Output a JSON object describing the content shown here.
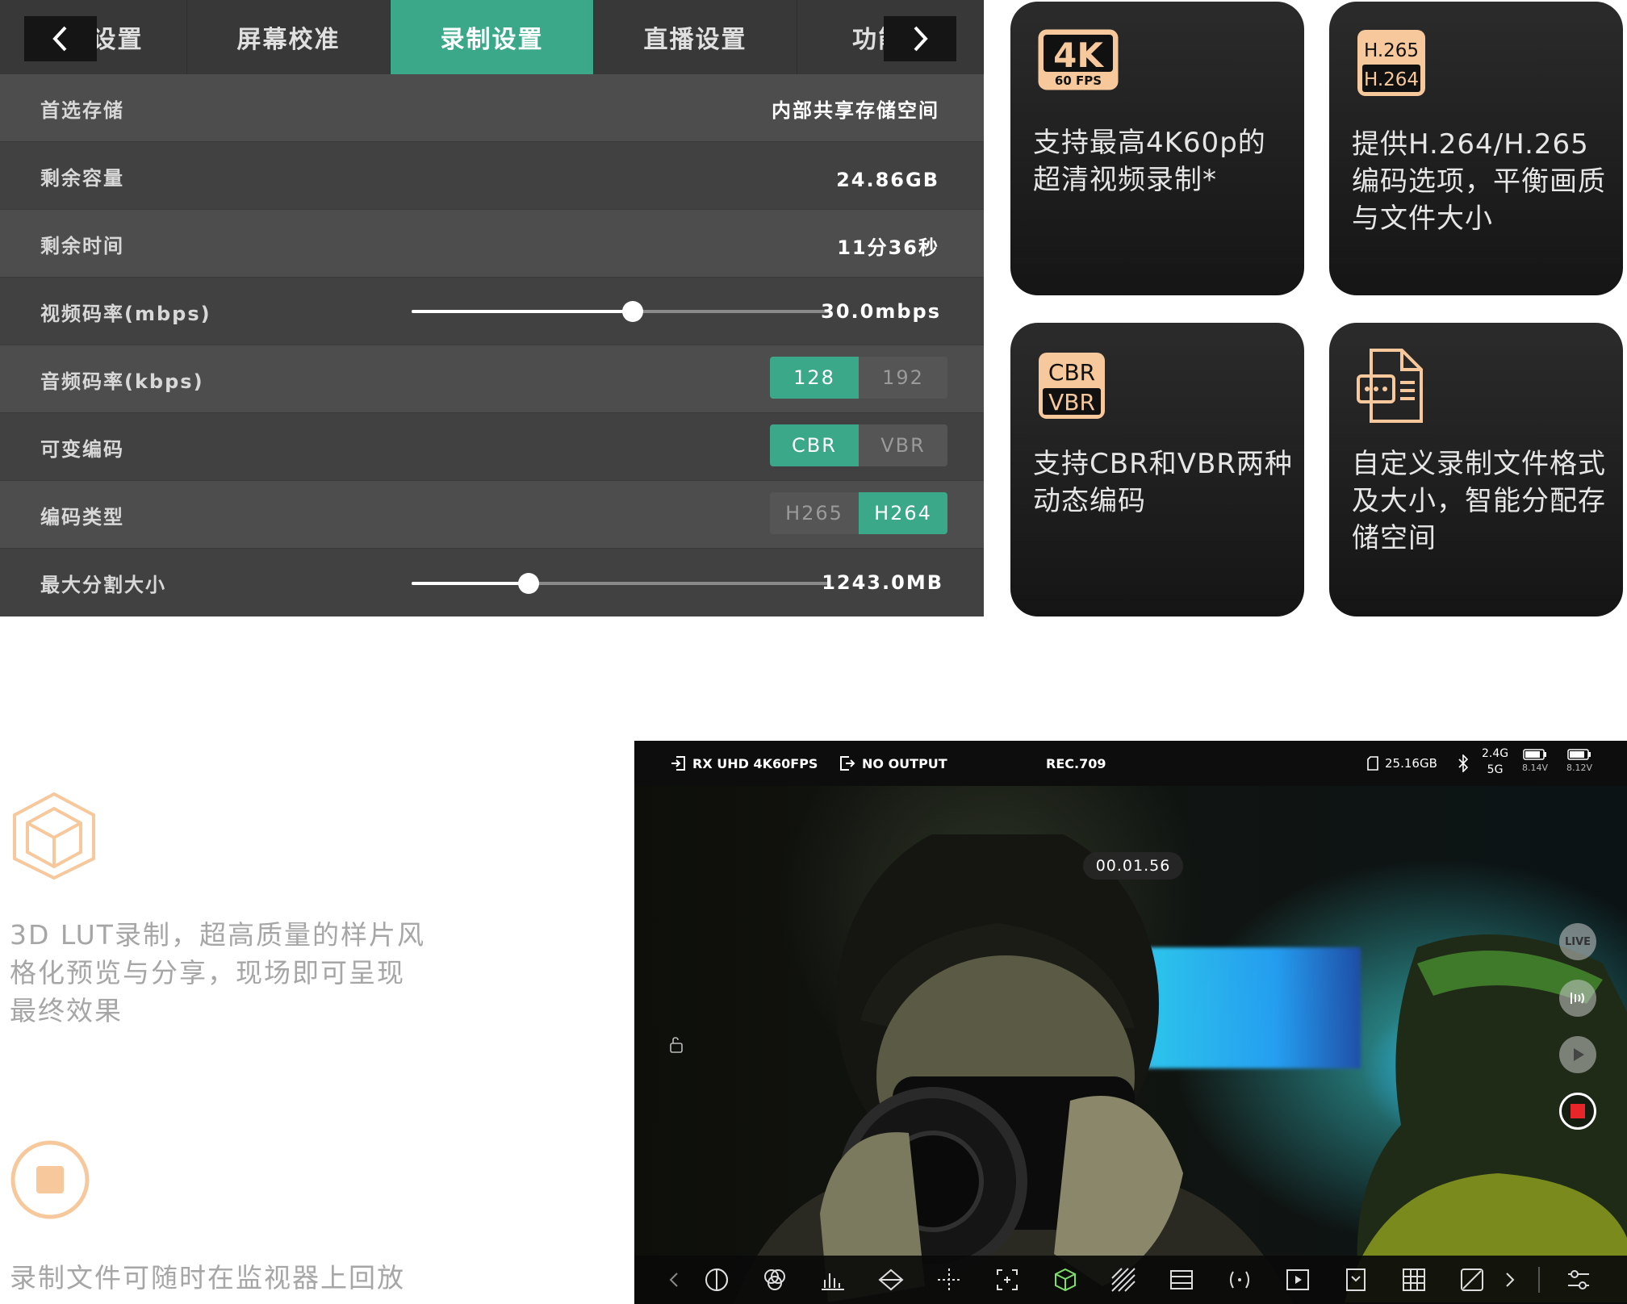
{
  "settings": {
    "tabs": [
      "设置",
      "屏幕校准",
      "录制设置",
      "直播设置",
      "功能"
    ],
    "active_tab": "录制设置",
    "rows": {
      "storage": {
        "label": "首选存储",
        "value": "内部共享存储空间"
      },
      "capacity": {
        "label": "剩余容量",
        "value": "24.86GB"
      },
      "time": {
        "label": "剩余时间",
        "value": "11分36秒"
      },
      "video_bitrate": {
        "label": "视频码率(mbps)",
        "value": "30.0mbps",
        "level": 0.53
      },
      "audio_bitrate": {
        "label": "音频码率(kbps)",
        "options": [
          "128",
          "192"
        ],
        "selected": "128"
      },
      "variable_encoding": {
        "label": "可变编码",
        "options": [
          "CBR",
          "VBR"
        ],
        "selected": "CBR"
      },
      "codec_type": {
        "label": "编码类型",
        "options": [
          "H265",
          "H264"
        ],
        "selected": "H264"
      },
      "max_split": {
        "label": "最大分割大小",
        "value": "1243.0MB",
        "level": 0.28
      }
    }
  },
  "cards": [
    {
      "icon_label": "4K",
      "icon_sub": "60 FPS",
      "text": "支持最高4K60p的超清视频录制*"
    },
    {
      "icon_label": "H.265",
      "icon_sub": "H.264",
      "text": "提供H.264/H.265编码选项，平衡画质与文件大小"
    },
    {
      "icon_label": "CBR",
      "icon_sub": "VBR",
      "text": "支持CBR和VBR两种动态编码"
    },
    {
      "icon_label": "file-settings-icon",
      "text": "自定义录制文件格式及大小，智能分配存储空间"
    }
  ],
  "features": {
    "lut_text": "3D LUT录制，超高质量的样片风格化预览与分享，现场即可呈现最终效果",
    "playback_text": "录制文件可随时在监视器上回放"
  },
  "monitor": {
    "input": "RX UHD 4K60FPS",
    "output": "NO OUTPUT",
    "color_space": "REC.709",
    "storage": "25.16GB",
    "band_top": "2.4G",
    "band_bottom": "5G",
    "battery1": "8.14V",
    "battery2": "8.12V",
    "timecode": "00.01.56",
    "live_label": "LIVE"
  },
  "colors": {
    "accent_green": "#3ba88a",
    "accent_orange": "#f7c89b",
    "record_red": "#e8262a"
  }
}
